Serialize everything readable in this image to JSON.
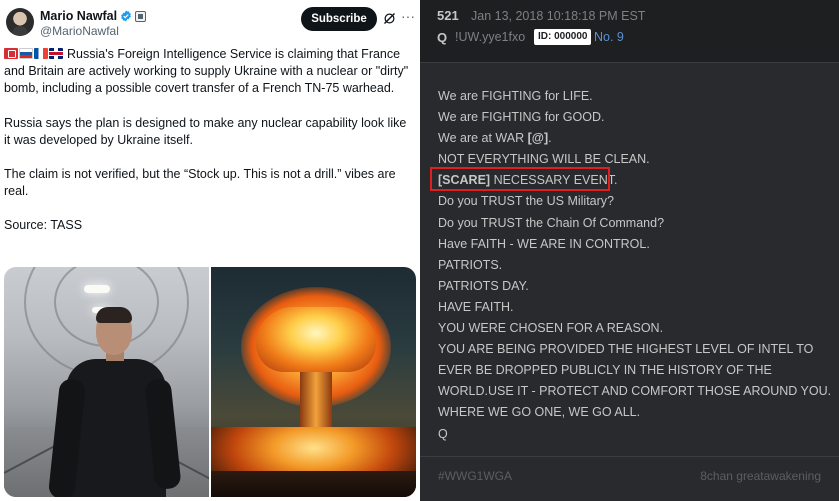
{
  "tweet": {
    "author_name": "Mario Nawfal",
    "author_handle": "@MarioNawfal",
    "subscribe_label": "Subscribe",
    "more_label": "···",
    "paragraphs": [
      "Russia's Foreign Intelligence Service is claiming that France and Britain are actively working to supply Ukraine with a nuclear or \"dirty\" bomb, including a possible covert transfer of a French TN-75 warhead.",
      "Russia says the plan is designed to make any nuclear capability look like it was developed by Ukraine itself.",
      "The claim is not verified, but the “Stock up. This is not a drill.” vibes are real.",
      "Source: TASS"
    ],
    "flag_icons": [
      "red-alert-flag-icon",
      "russia-flag-icon",
      "france-flag-icon",
      "uk-flag-icon"
    ],
    "colors": {
      "subscribe_bg": "#0f1419",
      "verified_blue": "#1d9bf0"
    }
  },
  "qpost": {
    "post_number": "521",
    "date": "Jan 13, 2018 10:18:18 PM EST",
    "name": "Q",
    "tripcode": "!UW.yye1fxo",
    "id_badge": "ID: 000000",
    "post_no": "No. 9",
    "lines": [
      {
        "text": "We are FIGHTING for LIFE."
      },
      {
        "text": "We are FIGHTING for GOOD."
      },
      {
        "pre": "We are at WAR ",
        "bold": "[@]",
        "post": "."
      },
      {
        "text": "NOT EVERYTHING WILL BE CLEAN."
      },
      {
        "pre": "",
        "bold": "[SCARE]",
        "post": " NECESSARY EVENT."
      },
      {
        "text": "Do you TRUST the US Military?"
      },
      {
        "text": "Do you TRUST the Chain Of Command?"
      },
      {
        "text": "Have FAITH - WE ARE IN CONTROL."
      },
      {
        "text": "PATRIOTS."
      },
      {
        "text": "PATRIOTS DAY."
      },
      {
        "text": "HAVE FAITH."
      },
      {
        "text": "YOU WERE CHOSEN FOR A REASON."
      },
      {
        "text": "YOU ARE BEING PROVIDED THE HIGHEST LEVEL OF INTEL TO"
      },
      {
        "text": "EVER BE DROPPED PUBLICLY IN THE HISTORY OF THE"
      },
      {
        "text": "WORLD.USE IT - PROTECT AND COMFORT THOSE AROUND YOU."
      },
      {
        "text": "WHERE WE GO ONE, WE GO ALL."
      },
      {
        "text": "Q"
      }
    ],
    "hashtag": "#WWG1WGA",
    "source": "8chan greatawakening",
    "colors": {
      "panel_bg": "#282a2e",
      "header_bg": "#1d1f21",
      "highlight_box": "#e02020",
      "link_blue": "#5b8fd6"
    }
  }
}
